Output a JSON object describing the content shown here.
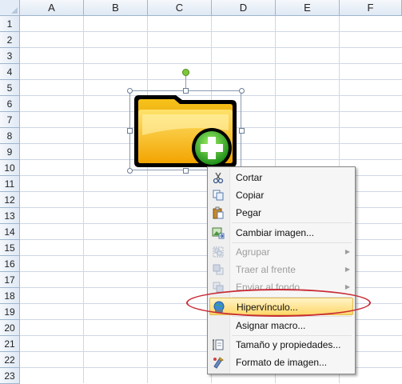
{
  "columns": [
    "A",
    "B",
    "C",
    "D",
    "E",
    "F"
  ],
  "rows": [
    "1",
    "2",
    "3",
    "4",
    "5",
    "6",
    "7",
    "8",
    "9",
    "10",
    "11",
    "12",
    "13",
    "14",
    "15",
    "16",
    "17",
    "18",
    "19",
    "20",
    "21",
    "22",
    "23"
  ],
  "picture": {
    "icon": "folder-add-icon"
  },
  "menu": {
    "items": [
      {
        "label": "Cortar",
        "icon": "scissors-icon",
        "enabled": true
      },
      {
        "label": "Copiar",
        "icon": "copy-icon",
        "enabled": true
      },
      {
        "label": "Pegar",
        "icon": "paste-icon",
        "enabled": true
      },
      {
        "label": "Cambiar imagen...",
        "icon": "change-picture-icon",
        "enabled": true
      },
      {
        "label": "Agrupar",
        "icon": "group-icon",
        "enabled": false,
        "submenu": true
      },
      {
        "label": "Traer al frente",
        "icon": "bring-front-icon",
        "enabled": false,
        "submenu": true
      },
      {
        "label": "Enviar al fondo",
        "icon": "send-back-icon",
        "enabled": false,
        "submenu": true
      },
      {
        "label": "Hipervínculo...",
        "icon": "hyperlink-icon",
        "enabled": true,
        "highlighted": true
      },
      {
        "label": "Asignar macro...",
        "icon": "",
        "enabled": true
      },
      {
        "label": "Tamaño y propiedades...",
        "icon": "size-properties-icon",
        "enabled": true
      },
      {
        "label": "Formato de imagen...",
        "icon": "format-picture-icon",
        "enabled": true
      }
    ]
  },
  "colors": {
    "highlight_oval": "#c92b35",
    "header_bg": "#dfe8f4"
  }
}
